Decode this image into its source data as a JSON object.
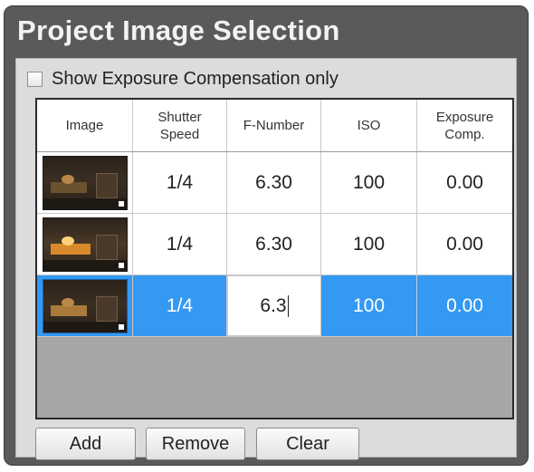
{
  "panel": {
    "title": "Project Image Selection"
  },
  "filter": {
    "checkbox_label": "Show Exposure Compensation only",
    "checked": false
  },
  "grid": {
    "headers": {
      "image": "Image",
      "shutter_speed": "Shutter\nSpeed",
      "f_number": "F-Number",
      "iso": "ISO",
      "exposure_comp": "Exposure\nComp."
    },
    "rows": [
      {
        "shutter_speed": "1/4",
        "f_number": "6.30",
        "iso": "100",
        "exposure_comp": "0.00",
        "thumbnail": "dark-room-thumbnail",
        "selected": false
      },
      {
        "shutter_speed": "1/4",
        "f_number": "6.30",
        "iso": "100",
        "exposure_comp": "0.00",
        "thumbnail": "lit-room-thumbnail",
        "selected": false
      },
      {
        "shutter_speed": "1/4",
        "f_number": "6.3",
        "iso": "100",
        "exposure_comp": "0.00",
        "thumbnail": "room-thumbnail",
        "selected": true,
        "editing_field": "f_number"
      }
    ]
  },
  "buttons": {
    "add": "Add",
    "remove": "Remove",
    "clear": "Clear"
  },
  "colors": {
    "panel_bg": "#5a5a5a",
    "selection": "#3399f3"
  }
}
